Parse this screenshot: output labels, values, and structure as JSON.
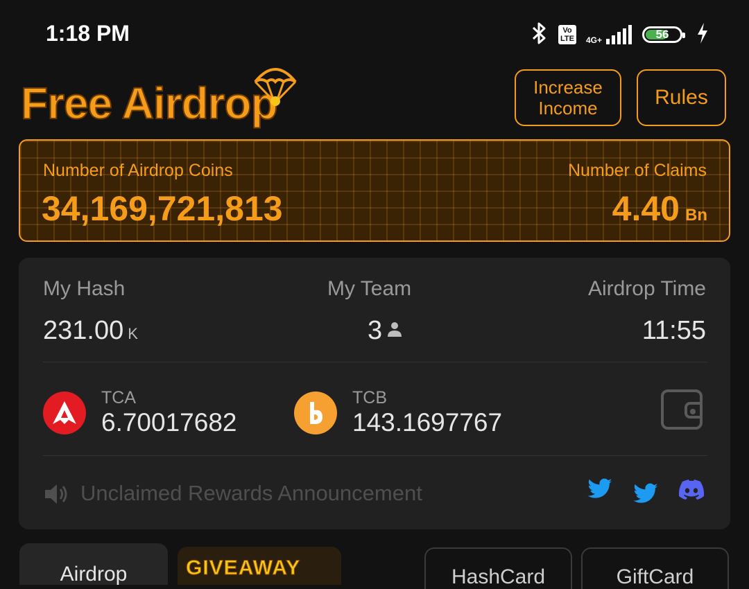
{
  "status_bar": {
    "time": "1:18 PM",
    "volte": "Vo\nLTE",
    "network": "4G+",
    "battery": "56"
  },
  "header": {
    "logo_text": "Free Airdrop",
    "increase_income_label": "Increase\nIncome",
    "rules_label": "Rules"
  },
  "banner": {
    "coins_label": "Number of Airdrop Coins",
    "coins_value": "34,169,721,813",
    "claims_label": "Number of Claims",
    "claims_value": "4.40",
    "claims_unit": "Bn"
  },
  "stats": {
    "hash_label": "My Hash",
    "hash_value": "231.00",
    "hash_unit": "K",
    "team_label": "My Team",
    "team_value": "3",
    "time_label": "Airdrop Time",
    "time_value": "11:55"
  },
  "coins": [
    {
      "name": "TCA",
      "balance": "6.70017682",
      "color": "#e31b23"
    },
    {
      "name": "TCB",
      "balance": "143.1697767",
      "color": "#f5a031"
    }
  ],
  "announcement": "Unclaimed Rewards Announcement",
  "tabs": {
    "airdrop": "Airdrop",
    "giveaway": "GIVEAWAY",
    "hashcard": "HashCard",
    "giftcard": "GiftCard"
  },
  "colors": {
    "accent": "#f59c1a",
    "background": "#121212",
    "card": "#212121",
    "twitter": "#1d9bf0",
    "discord": "#5865f2"
  },
  "icons": [
    "bluetooth-icon",
    "signal-icon",
    "charging-icon",
    "parachute-icon",
    "person-icon",
    "wallet-icon",
    "speaker-icon",
    "twitter-icon",
    "discord-icon"
  ]
}
